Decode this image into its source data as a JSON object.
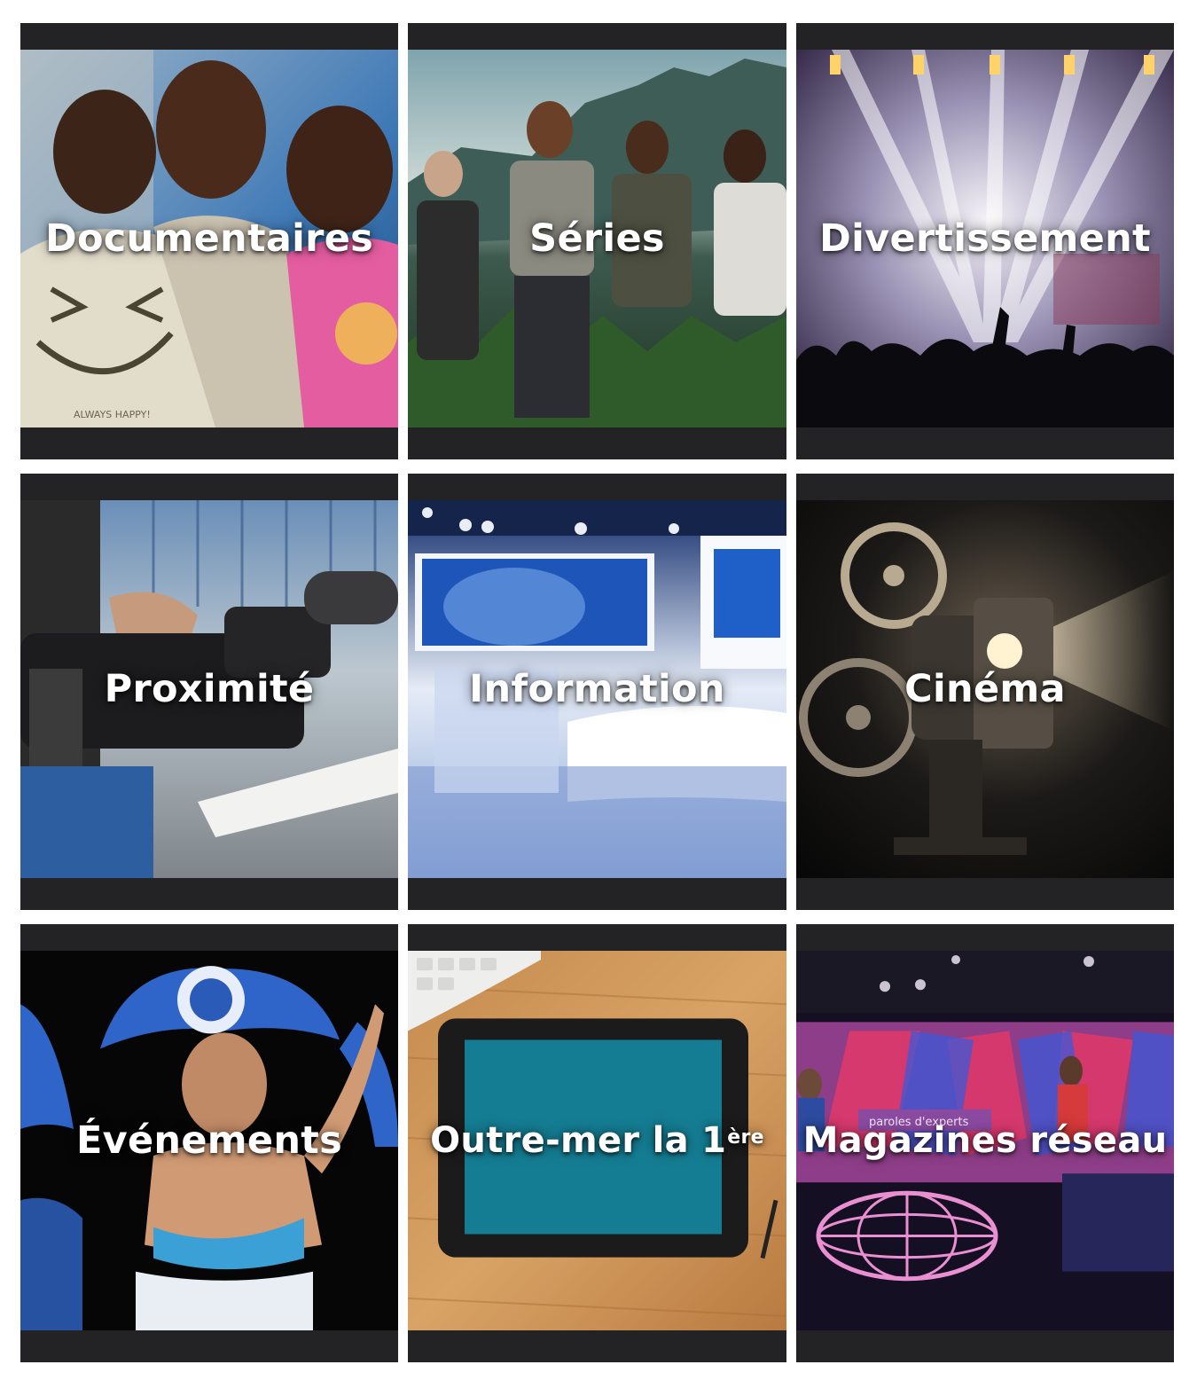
{
  "categories": [
    {
      "id": "documentaires",
      "label": "Documentaires"
    },
    {
      "id": "series",
      "label": "Séries"
    },
    {
      "id": "divertissement",
      "label": "Divertissement"
    },
    {
      "id": "proximite",
      "label": "Proximité"
    },
    {
      "id": "information",
      "label": "Information"
    },
    {
      "id": "cinema",
      "label": "Cinéma"
    },
    {
      "id": "evenements",
      "label": "Événements"
    },
    {
      "id": "outremer",
      "label": "Outre-mer la 1",
      "label_sup": "ère"
    },
    {
      "id": "magazines",
      "label": "Magazines réseau"
    }
  ],
  "photo_text": {
    "shirt_print": "ALWAYS HAPPY!",
    "studio_sign": "paroles d'experts"
  },
  "colors": {
    "tile_frame": "#232325",
    "label": "#ffffff",
    "page_background": "#ffffff"
  }
}
